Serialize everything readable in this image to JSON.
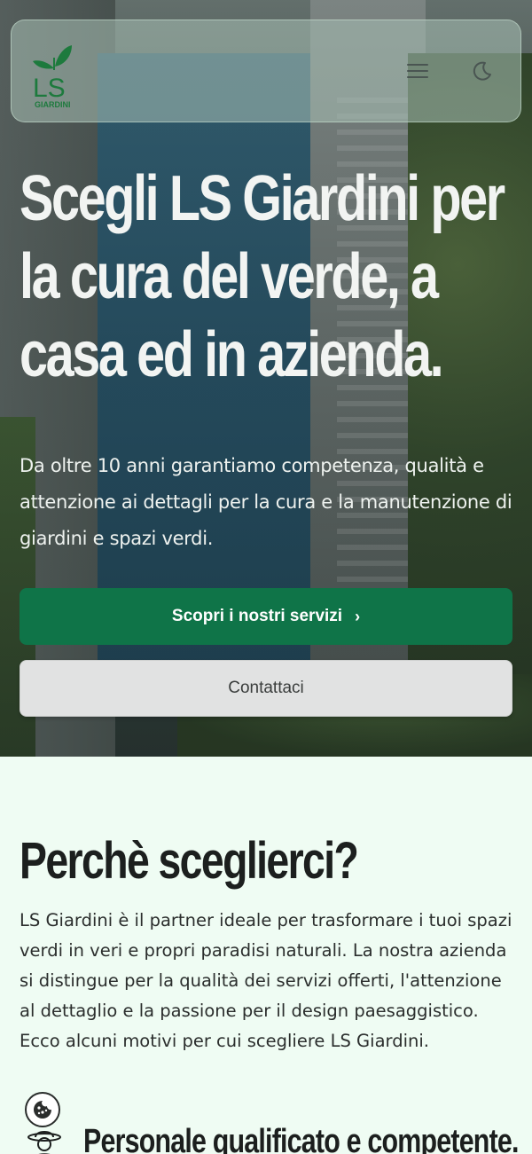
{
  "header": {
    "logo_letters": "LS",
    "logo_word": "GIARDINI",
    "menu_icon": "hamburger-menu-icon",
    "theme_icon": "moon-icon"
  },
  "hero": {
    "title": "Scegli LS Giardini per la cura del verde, a casa ed in azienda.",
    "subtitle": "Da oltre 10 anni garantiamo competenza, qualità e attenzione ai dettagli per la cura e la manutenzione di giardini e spazi verdi.",
    "primary_button": "Scopri i nostri servizi",
    "primary_button_icon": "chevron-right-icon",
    "secondary_button": "Contattaci"
  },
  "why": {
    "title": "Perchè sceglierci?",
    "text": "LS Giardini è il partner ideale per trasformare i tuoi spazi verdi in veri e propri paradisi naturali. La nostra azienda si distingue per la qualità dei servizi offerti, l'attenzione al dettaglio e la passione per il design paesaggistico. Ecco alcuni motivi per cui scegliere LS Giardini."
  },
  "feature": {
    "title": "Personale qualificato e competente.",
    "icon": "gardener-icon"
  },
  "cookie": {
    "icon": "cookie-icon"
  },
  "colors": {
    "brand_green": "#0f7448",
    "section_bg": "#effcf3"
  }
}
